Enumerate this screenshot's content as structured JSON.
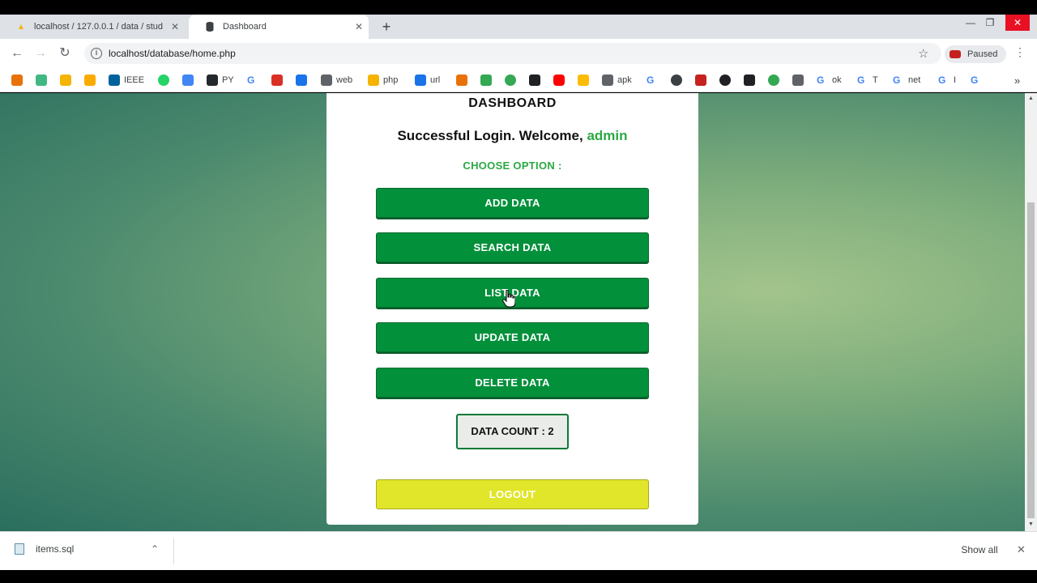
{
  "browser": {
    "tabs": [
      {
        "title": "localhost / 127.0.0.1 / data / stud",
        "active": false
      },
      {
        "title": "Dashboard",
        "active": true
      }
    ],
    "address": "localhost/database/home.php",
    "profile_status": "Paused",
    "bookmarks": [
      {
        "label": "",
        "icon": "orange-diamond",
        "color": "#e8710a"
      },
      {
        "label": "",
        "icon": "v-logo",
        "color": "#41b883"
      },
      {
        "label": "",
        "icon": "yellow-square",
        "color": "#f4b400"
      },
      {
        "label": "",
        "icon": "bar-chart",
        "color": "#f9ab00"
      },
      {
        "label": "IEEE",
        "icon": "ieee-logo",
        "color": "#00629b"
      },
      {
        "label": "",
        "icon": "whatsapp",
        "color": "#25d366"
      },
      {
        "label": "",
        "icon": "pen-icon",
        "color": "#4285f4"
      },
      {
        "label": "PY",
        "icon": "github",
        "color": "#24292e"
      },
      {
        "label": "",
        "icon": "google-g",
        "color": "#4285f4"
      },
      {
        "label": "",
        "icon": "red-badge",
        "color": "#d93025"
      },
      {
        "label": "",
        "icon": "triangle",
        "color": "#1a73e8"
      },
      {
        "label": "web",
        "icon": "filter",
        "color": "#5f6368"
      },
      {
        "label": "php",
        "icon": "pma-logo",
        "color": "#f4b400"
      },
      {
        "label": "url",
        "icon": "building",
        "color": "#1a73e8"
      },
      {
        "label": "",
        "icon": "sun",
        "color": "#e8710a"
      },
      {
        "label": "",
        "icon": "car",
        "color": "#34a853"
      },
      {
        "label": "",
        "icon": "ring",
        "color": "#34a853"
      },
      {
        "label": "",
        "icon": "arrow",
        "color": "#202124"
      },
      {
        "label": "",
        "icon": "youtube",
        "color": "#ff0000"
      },
      {
        "label": "",
        "icon": "p-badge",
        "color": "#fbbc04"
      },
      {
        "label": "apk",
        "icon": "gamepad",
        "color": "#5f6368"
      },
      {
        "label": "",
        "icon": "google-g",
        "color": "#4285f4"
      },
      {
        "label": "",
        "icon": "globe-dark",
        "color": "#3c4043"
      },
      {
        "label": "",
        "icon": "tl-red",
        "color": "#c5221f"
      },
      {
        "label": "",
        "icon": "globe",
        "color": "#202124"
      },
      {
        "label": "",
        "icon": "cl-dark",
        "color": "#202124"
      },
      {
        "label": "",
        "icon": "green-circle",
        "color": "#34a853"
      },
      {
        "label": "",
        "icon": "y-letter",
        "color": "#5f6368"
      },
      {
        "label": "ok",
        "icon": "google-g",
        "color": "#4285f4"
      },
      {
        "label": "T",
        "icon": "google-g",
        "color": "#4285f4"
      },
      {
        "label": "net",
        "icon": "google-g",
        "color": "#4285f4"
      },
      {
        "label": "I",
        "icon": "google-g",
        "color": "#4285f4"
      },
      {
        "label": "",
        "icon": "google-g",
        "color": "#4285f4"
      }
    ]
  },
  "page": {
    "heading": "DASHBOARD",
    "welcome_prefix": "Successful Login. Welcome,",
    "username": "admin",
    "choose_label": "CHOOSE OPTION :",
    "buttons": {
      "add": "ADD DATA",
      "search": "SEARCH DATA",
      "list": "LIST DATA",
      "update": "UPDATE DATA",
      "delete": "DELETE DATA"
    },
    "data_count": "DATA COUNT : 2",
    "logout": "LOGOUT",
    "colors": {
      "primary_green": "#03903b",
      "accent_green": "#2ba844",
      "logout_yellow": "#e1e62a"
    }
  },
  "downloads": {
    "file": "items.sql",
    "show_all": "Show all"
  }
}
